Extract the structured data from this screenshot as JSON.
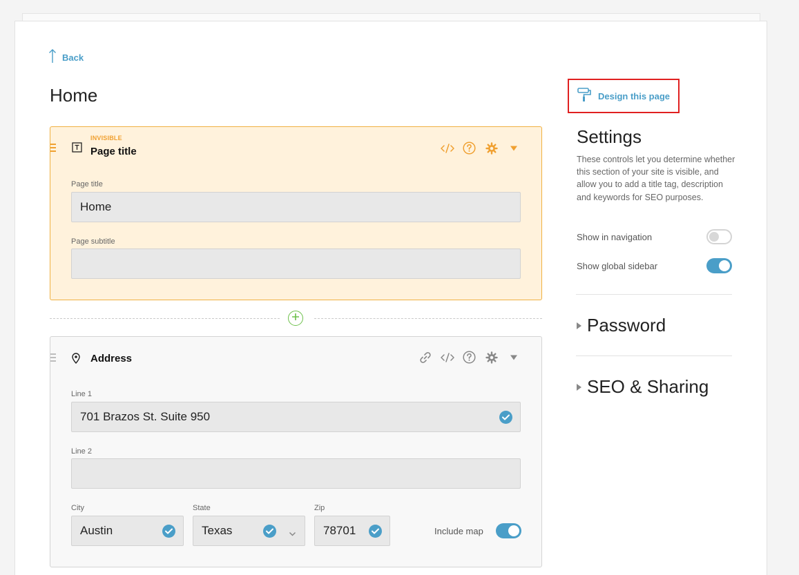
{
  "nav": {
    "back_label": "Back"
  },
  "page": {
    "title": "Home"
  },
  "sections": {
    "page_title": {
      "tag": "INVISIBLE",
      "title": "Page title",
      "fields": {
        "title_label": "Page title",
        "title_value": "Home",
        "subtitle_label": "Page subtitle",
        "subtitle_value": ""
      }
    },
    "address": {
      "title": "Address",
      "line1_label": "Line 1",
      "line1_value": "701 Brazos St. Suite 950",
      "line2_label": "Line 2",
      "line2_value": "",
      "city_label": "City",
      "city_value": "Austin",
      "state_label": "State",
      "state_value": "Texas",
      "zip_label": "Zip",
      "zip_value": "78701",
      "include_map_label": "Include map",
      "include_map_on": true
    }
  },
  "sidebar": {
    "design_label": "Design this page",
    "settings_title": "Settings",
    "settings_desc": "These controls let you determine whether this section of your site is visible, and allow you to add a title tag, description and keywords for SEO purposes.",
    "show_nav_label": "Show in navigation",
    "show_nav_on": false,
    "show_sidebar_label": "Show global sidebar",
    "show_sidebar_on": true,
    "password_label": "Password",
    "seo_label": "SEO & Sharing"
  },
  "colors": {
    "accent": "#4a9ec8",
    "invisible_bg": "#fff2dc",
    "invisible_accent": "#f0a030",
    "add_green": "#6cc04a",
    "highlight_red": "#e02020"
  },
  "icons": {
    "back": "arrow-up-icon",
    "design": "paint-roller-icon",
    "page_title_section": "text-box-icon",
    "address_section": "map-pin-icon",
    "tools": [
      "link-icon",
      "code-icon",
      "help-icon",
      "gear-icon",
      "caret-down-icon"
    ],
    "add": "plus-circle-icon",
    "check": "check-circle-icon"
  }
}
